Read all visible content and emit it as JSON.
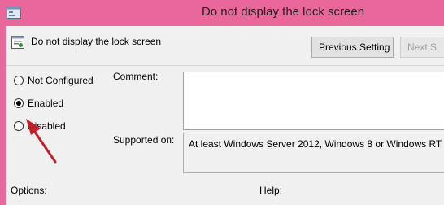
{
  "window": {
    "title": "Do not display the lock screen",
    "accent": "#e9679a"
  },
  "header": {
    "policy_icon": "policy-setting-icon",
    "title": "Do not display the lock screen"
  },
  "buttons": {
    "previous": "Previous Setting",
    "next": "Next S"
  },
  "state_options": [
    {
      "label": "Not Configured",
      "selected": false
    },
    {
      "label": "Enabled",
      "selected": true
    },
    {
      "label": "Disabled",
      "selected": false
    }
  ],
  "fields": {
    "comment_label": "Comment:",
    "comment_value": "",
    "supported_label": "Supported on:",
    "supported_value": "At least Windows Server 2012, Windows 8 or Windows RT"
  },
  "footer": {
    "options_label": "Options:",
    "help_label": "Help:"
  },
  "annotation": {
    "arrow_color": "#c0202a"
  }
}
